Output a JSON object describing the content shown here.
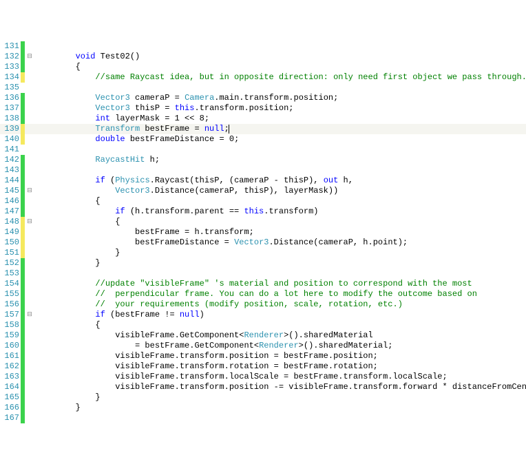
{
  "lines": [
    {
      "n": 131,
      "marker": "green",
      "fold": "",
      "indent": 0,
      "tokens": []
    },
    {
      "n": 132,
      "marker": "green",
      "fold": "⊟",
      "indent": 8,
      "tokens": [
        {
          "t": "void",
          "c": "kw"
        },
        {
          "t": " Test02()"
        }
      ]
    },
    {
      "n": 133,
      "marker": "green",
      "fold": "",
      "indent": 8,
      "tokens": [
        {
          "t": "{"
        }
      ]
    },
    {
      "n": 134,
      "marker": "yellow",
      "fold": "",
      "indent": 12,
      "tokens": [
        {
          "t": "//same Raycast idea, but in opposite direction: only need first object we pass through.",
          "c": "cmt"
        }
      ]
    },
    {
      "n": 135,
      "marker": "",
      "fold": "",
      "indent": 0,
      "tokens": []
    },
    {
      "n": 136,
      "marker": "green",
      "fold": "",
      "indent": 12,
      "tokens": [
        {
          "t": "Vector3",
          "c": "type"
        },
        {
          "t": " cameraP = "
        },
        {
          "t": "Camera",
          "c": "type"
        },
        {
          "t": ".main.transform.position;"
        }
      ]
    },
    {
      "n": 137,
      "marker": "green",
      "fold": "",
      "indent": 12,
      "tokens": [
        {
          "t": "Vector3",
          "c": "type"
        },
        {
          "t": " thisP = "
        },
        {
          "t": "this",
          "c": "kw"
        },
        {
          "t": ".transform.position;"
        }
      ]
    },
    {
      "n": 138,
      "marker": "green",
      "fold": "",
      "indent": 12,
      "tokens": [
        {
          "t": "int",
          "c": "kw"
        },
        {
          "t": " layerMask = 1 << 8;"
        }
      ]
    },
    {
      "n": 139,
      "marker": "yellow",
      "fold": "",
      "indent": 12,
      "current": true,
      "tokens": [
        {
          "t": "Transform",
          "c": "type"
        },
        {
          "t": " bestFrame = "
        },
        {
          "t": "null",
          "c": "kw"
        },
        {
          "t": ";"
        },
        {
          "t": "",
          "caret": true
        }
      ]
    },
    {
      "n": 140,
      "marker": "yellow",
      "fold": "",
      "indent": 12,
      "tokens": [
        {
          "t": "double",
          "c": "kw"
        },
        {
          "t": " bestFrameDistance = 0;"
        }
      ]
    },
    {
      "n": 141,
      "marker": "",
      "fold": "",
      "indent": 0,
      "tokens": []
    },
    {
      "n": 142,
      "marker": "green",
      "fold": "",
      "indent": 12,
      "tokens": [
        {
          "t": "RaycastHit",
          "c": "type"
        },
        {
          "t": " h;"
        }
      ]
    },
    {
      "n": 143,
      "marker": "green",
      "fold": "",
      "indent": 0,
      "tokens": []
    },
    {
      "n": 144,
      "marker": "green",
      "fold": "",
      "indent": 12,
      "tokens": [
        {
          "t": "if",
          "c": "kw"
        },
        {
          "t": " ("
        },
        {
          "t": "Physics",
          "c": "type"
        },
        {
          "t": ".Raycast(thisP, (cameraP - thisP), "
        },
        {
          "t": "out",
          "c": "kw"
        },
        {
          "t": " h,"
        }
      ]
    },
    {
      "n": 145,
      "marker": "green",
      "fold": "⊟",
      "indent": 16,
      "tokens": [
        {
          "t": "Vector3",
          "c": "type"
        },
        {
          "t": ".Distance(cameraP, thisP), layerMask))"
        }
      ]
    },
    {
      "n": 146,
      "marker": "green",
      "fold": "",
      "indent": 12,
      "tokens": [
        {
          "t": "{"
        }
      ]
    },
    {
      "n": 147,
      "marker": "green",
      "fold": "",
      "indent": 16,
      "tokens": [
        {
          "t": "if",
          "c": "kw"
        },
        {
          "t": " (h.transform.parent == "
        },
        {
          "t": "this",
          "c": "kw"
        },
        {
          "t": ".transform)"
        }
      ]
    },
    {
      "n": 148,
      "marker": "yellow",
      "fold": "⊟",
      "indent": 16,
      "tokens": [
        {
          "t": "{"
        }
      ]
    },
    {
      "n": 149,
      "marker": "yellow",
      "fold": "",
      "indent": 20,
      "tokens": [
        {
          "t": "bestFrame = h.transform;"
        }
      ]
    },
    {
      "n": 150,
      "marker": "yellow",
      "fold": "",
      "indent": 20,
      "tokens": [
        {
          "t": "bestFrameDistance = "
        },
        {
          "t": "Vector3",
          "c": "type"
        },
        {
          "t": ".Distance(cameraP, h.point);"
        }
      ]
    },
    {
      "n": 151,
      "marker": "yellow",
      "fold": "",
      "indent": 16,
      "tokens": [
        {
          "t": "}"
        }
      ]
    },
    {
      "n": 152,
      "marker": "green",
      "fold": "",
      "indent": 12,
      "tokens": [
        {
          "t": "}"
        }
      ]
    },
    {
      "n": 153,
      "marker": "green",
      "fold": "",
      "indent": 0,
      "tokens": []
    },
    {
      "n": 154,
      "marker": "green",
      "fold": "",
      "indent": 12,
      "tokens": [
        {
          "t": "//update \"visibleFrame\" 's material and position to correspond with the most",
          "c": "cmt"
        }
      ]
    },
    {
      "n": 155,
      "marker": "green",
      "fold": "",
      "indent": 12,
      "tokens": [
        {
          "t": "//  perpendicular frame. You can do a lot here to modify the outcome based on",
          "c": "cmt"
        }
      ]
    },
    {
      "n": 156,
      "marker": "green",
      "fold": "",
      "indent": 12,
      "tokens": [
        {
          "t": "//  your requirements (modify position, scale, rotation, etc.)",
          "c": "cmt"
        }
      ]
    },
    {
      "n": 157,
      "marker": "green",
      "fold": "⊟",
      "indent": 12,
      "tokens": [
        {
          "t": "if",
          "c": "kw"
        },
        {
          "t": " (bestFrame != "
        },
        {
          "t": "null",
          "c": "kw"
        },
        {
          "t": ")"
        }
      ]
    },
    {
      "n": 158,
      "marker": "green",
      "fold": "",
      "indent": 12,
      "tokens": [
        {
          "t": "{"
        }
      ]
    },
    {
      "n": 159,
      "marker": "green",
      "fold": "",
      "indent": 16,
      "tokens": [
        {
          "t": "visibleFrame.GetComponent<"
        },
        {
          "t": "Renderer",
          "c": "type"
        },
        {
          "t": ">().sharedMaterial"
        }
      ]
    },
    {
      "n": 160,
      "marker": "green",
      "fold": "",
      "indent": 20,
      "tokens": [
        {
          "t": "= bestFrame.GetComponent<"
        },
        {
          "t": "Renderer",
          "c": "type"
        },
        {
          "t": ">().sharedMaterial;"
        }
      ]
    },
    {
      "n": 161,
      "marker": "green",
      "fold": "",
      "indent": 16,
      "tokens": [
        {
          "t": "visibleFrame.transform.position = bestFrame.position;"
        }
      ]
    },
    {
      "n": 162,
      "marker": "green",
      "fold": "",
      "indent": 16,
      "tokens": [
        {
          "t": "visibleFrame.transform.rotation = bestFrame.rotation;"
        }
      ]
    },
    {
      "n": 163,
      "marker": "green",
      "fold": "",
      "indent": 16,
      "tokens": [
        {
          "t": "visibleFrame.transform.localScale = bestFrame.transform.localScale;"
        }
      ]
    },
    {
      "n": 164,
      "marker": "green",
      "fold": "",
      "indent": 16,
      "tokens": [
        {
          "t": "visibleFrame.transform.position -= visibleFrame.transform.forward * distanceFromCenter;"
        }
      ]
    },
    {
      "n": 165,
      "marker": "green",
      "fold": "",
      "indent": 12,
      "tokens": [
        {
          "t": "}"
        }
      ]
    },
    {
      "n": 166,
      "marker": "green",
      "fold": "",
      "indent": 8,
      "tokens": [
        {
          "t": "}"
        }
      ]
    },
    {
      "n": 167,
      "marker": "green",
      "fold": "",
      "indent": 0,
      "tokens": []
    }
  ]
}
